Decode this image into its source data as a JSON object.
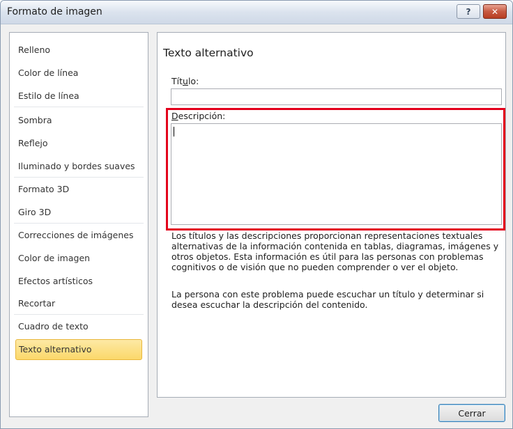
{
  "window": {
    "title": "Formato de imagen",
    "help_glyph": "?",
    "close_glyph": "✕"
  },
  "sidebar": {
    "items": [
      {
        "label": "Relleno"
      },
      {
        "label": "Color de línea"
      },
      {
        "label": "Estilo de línea"
      },
      {
        "label": "Sombra"
      },
      {
        "label": "Reflejo"
      },
      {
        "label": "Iluminado y bordes suaves"
      },
      {
        "label": "Formato 3D"
      },
      {
        "label": "Giro 3D"
      },
      {
        "label": "Correcciones de imágenes"
      },
      {
        "label": "Color de imagen"
      },
      {
        "label": "Efectos artísticos"
      },
      {
        "label": "Recortar"
      },
      {
        "label": "Cuadro de texto"
      },
      {
        "label": "Texto alternativo"
      }
    ],
    "selected": "Texto alternativo"
  },
  "main": {
    "title": "Texto alternativo",
    "titulo_label_pre": "Tít",
    "titulo_label_key": "u",
    "titulo_label_post": "lo:",
    "titulo_value": "",
    "descripcion_label_key": "D",
    "descripcion_label_post": "escripción:",
    "descripcion_value": "",
    "help_paragraph_1": "Los títulos y las descripciones proporcionan representaciones textuales alternativas de la información contenida en tablas, diagramas, imágenes y otros objetos. Esta información es útil para las personas con problemas cognitivos o de visión que no pueden comprender o ver el objeto.",
    "help_paragraph_2": "La persona con este problema puede escuchar un título y determinar si desea escuchar la descripción del contenido."
  },
  "footer": {
    "close_label": "Cerrar"
  },
  "colors": {
    "highlight": "#e3001b",
    "selected_bg": "#fbd86a",
    "title_bar": "#dbe3ee"
  }
}
